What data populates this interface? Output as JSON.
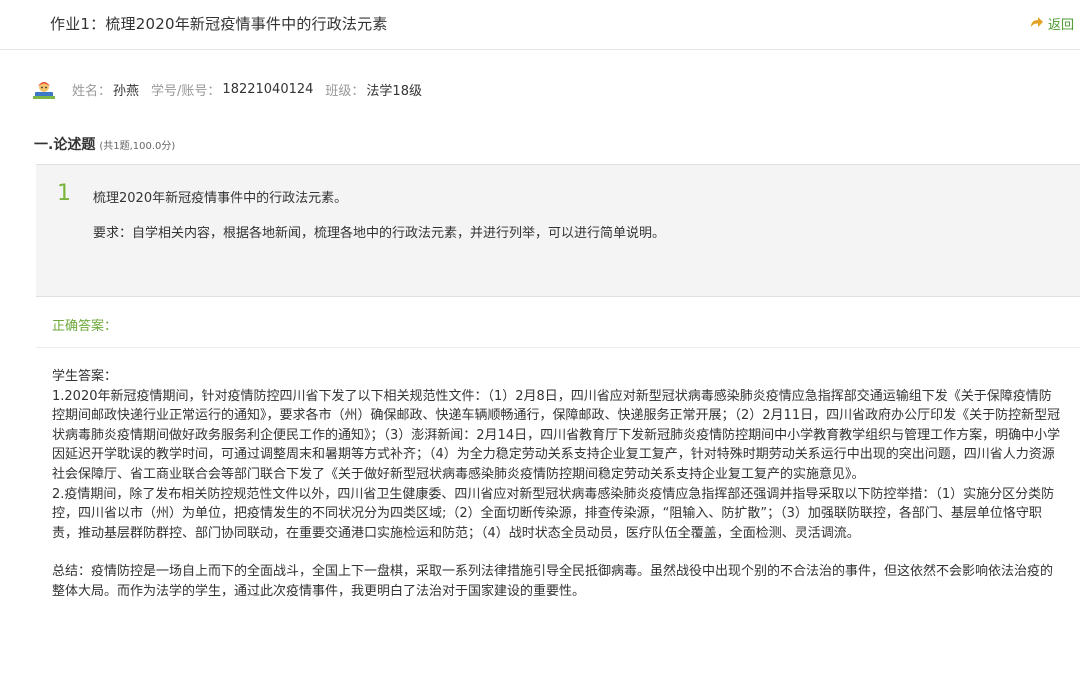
{
  "header": {
    "title": "作业1：梳理2020年新冠疫情事件中的行政法元素",
    "back_label": "返回"
  },
  "student": {
    "name_label": "姓名：",
    "name": "孙燕",
    "id_label": "学号/账号：",
    "id": "18221040124",
    "class_label": "班级：",
    "class": "法学18级"
  },
  "section": {
    "title": "一.论述题",
    "meta": "(共1题,100.0分)"
  },
  "question": {
    "number": "1",
    "text": "梳理2020年新冠疫情事件中的行政法元素。",
    "requirement": "要求：自学相关内容，根据各地新闻，梳理各地中的行政法元素，并进行列举，可以进行简单说明。"
  },
  "answer": {
    "correct_label": "正确答案：",
    "student_label": "学生答案：",
    "p1": "1.2020年新冠疫情期间，针对疫情防控四川省下发了以下相关规范性文件：（1）2月8日，四川省应对新型冠状病毒感染肺炎疫情应急指挥部交通运输组下发《关于保障疫情防控期间邮政快递行业正常运行的通知》，要求各市（州）确保邮政、快递车辆顺畅通行，保障邮政、快递服务正常开展；（2）2月11日，四川省政府办公厅印发《关于防控新型冠状病毒肺炎疫情期间做好政务服务利企便民工作的通知》；（3）澎湃新闻：2月14日，四川省教育厅下发新冠肺炎疫情防控期间中小学教育教学组织与管理工作方案，明确中小学因延迟开学耽误的教学时间，可通过调整周末和暑期等方式补齐；（4）为全力稳定劳动关系支持企业复工复产，针对特殊时期劳动关系运行中出现的突出问题，四川省人力资源社会保障厅、省工商业联合会等部门联合下发了《关于做好新型冠状病毒感染肺炎疫情防控期间稳定劳动关系支持企业复工复产的实施意见》。",
    "p2": "2.疫情期间，除了发布相关防控规范性文件以外，四川省卫生健康委、四川省应对新型冠状病毒感染肺炎疫情应急指挥部还强调并指导采取以下防控举措：（1）实施分区分类防控，四川省以市（州）为单位，把疫情发生的不同状况分为四类区域;（2）全面切断传染源，排查传染源，“阻输入、防扩散”；（3）加强联防联控，各部门、基层单位恪守职责，推动基层群防群控、部门协同联动，在重要交通港口实施检运和防范；（4）战时状态全员动员，医疗队伍全覆盖，全面检测、灵活调流。",
    "summary": "总结：疫情防控是一场自上而下的全面战斗，全国上下一盘棋，采取一系列法律措施引导全民抵御病毒。虽然战役中出现个别的不合法治的事件，但这依然不会影响依法治疫的整体大局。而作为法学的学生，通过此次疫情事件，我更明白了法治对于国家建设的重要性。"
  },
  "colors": {
    "accent_green": "#79b53c",
    "back_arrow": "#e2a325",
    "question_bg": "#f4f4f4"
  },
  "icons": {
    "back": "back-arrow-icon",
    "avatar": "student-avatar"
  }
}
